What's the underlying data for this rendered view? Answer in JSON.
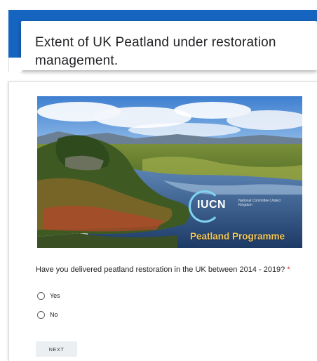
{
  "form": {
    "title": "Extent of UK Peatland under restoration management."
  },
  "banner": {
    "logo_text": "IUCN",
    "logo_subtitle": "National Committee United Kingdom",
    "programme_text": "Peatland Programme"
  },
  "question": {
    "text": "Have you delivered peatland restoration in the UK between 2014 - 2019?",
    "required_marker": "*",
    "options": [
      {
        "label": "Yes",
        "selected": false
      },
      {
        "label": "No",
        "selected": false
      }
    ]
  },
  "navigation": {
    "next_label": "NEXT"
  },
  "colors": {
    "header_blue": "#1565c0",
    "required_red": "#d93025"
  }
}
